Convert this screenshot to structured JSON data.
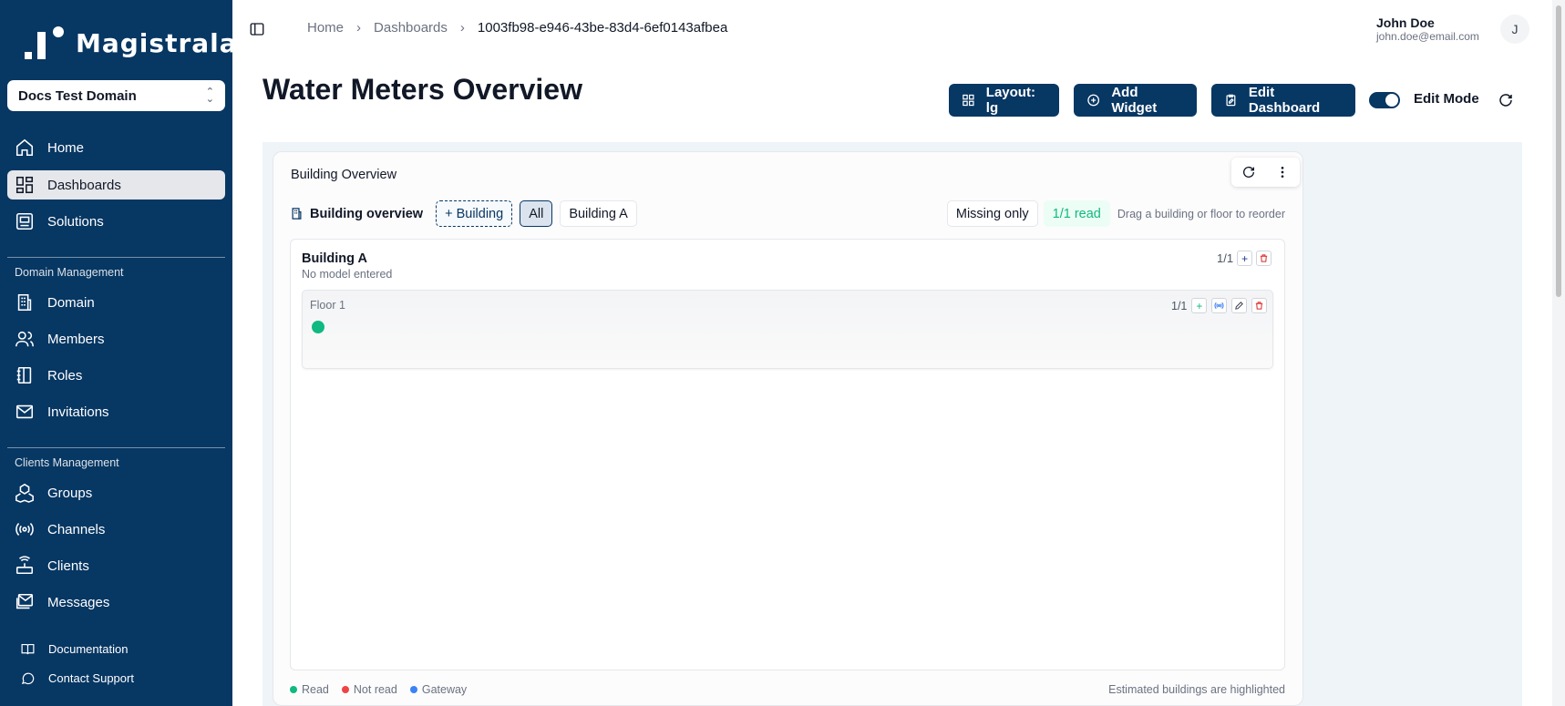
{
  "brand": {
    "name": "Magistrala"
  },
  "domain_select": {
    "value": "Docs Test Domain"
  },
  "sidebar": {
    "main": [
      {
        "label": "Home",
        "icon": "home-icon"
      },
      {
        "label": "Dashboards",
        "icon": "dashboards-icon",
        "active": true
      },
      {
        "label": "Solutions",
        "icon": "solutions-icon"
      }
    ],
    "domain_heading": "Domain Management",
    "domain_items": [
      {
        "label": "Domain",
        "icon": "building-icon"
      },
      {
        "label": "Members",
        "icon": "users-icon"
      },
      {
        "label": "Roles",
        "icon": "notebook-icon"
      },
      {
        "label": "Invitations",
        "icon": "mail-icon"
      }
    ],
    "clients_heading": "Clients Management",
    "clients_items": [
      {
        "label": "Groups",
        "icon": "groups-icon"
      },
      {
        "label": "Channels",
        "icon": "radio-icon"
      },
      {
        "label": "Clients",
        "icon": "router-icon"
      },
      {
        "label": "Messages",
        "icon": "messages-icon"
      }
    ],
    "footer": [
      {
        "label": "Documentation",
        "icon": "book-icon"
      },
      {
        "label": "Contact Support",
        "icon": "chat-icon"
      }
    ]
  },
  "breadcrumb": {
    "home": "Home",
    "dashboards": "Dashboards",
    "current": "1003fb98-e946-43be-83d4-6ef0143afbea"
  },
  "user": {
    "name": "John Doe",
    "email": "john.doe@email.com",
    "initial": "J"
  },
  "page": {
    "title": "Water Meters Overview"
  },
  "toolbar": {
    "layout_label": "Layout: lg",
    "add_widget_label": "Add Widget",
    "edit_dashboard_label": "Edit Dashboard",
    "edit_mode_label": "Edit Mode",
    "edit_mode_on": true
  },
  "widget": {
    "title": "Building Overview",
    "overview_label": "Building overview",
    "add_building": "+ Building",
    "filters": [
      "All",
      "Building A"
    ],
    "selected_filter": "All",
    "missing_only": "Missing only",
    "read_status": "1/1 read",
    "hint": "Drag a building or floor to reorder",
    "building": {
      "name": "Building A",
      "model": "No model entered",
      "count": "1/1",
      "floor": {
        "name": "Floor 1",
        "count": "1/1",
        "meter_status": "read"
      }
    },
    "legend": [
      {
        "label": "Read",
        "color": "#10b981"
      },
      {
        "label": "Not read",
        "color": "#ef4444"
      },
      {
        "label": "Gateway",
        "color": "#3b82f6"
      }
    ],
    "legend_note": "Estimated buildings are highlighted"
  },
  "colors": {
    "sidebar": "#073763",
    "accent": "#073763",
    "read": "#10b981",
    "danger": "#dc2626"
  }
}
